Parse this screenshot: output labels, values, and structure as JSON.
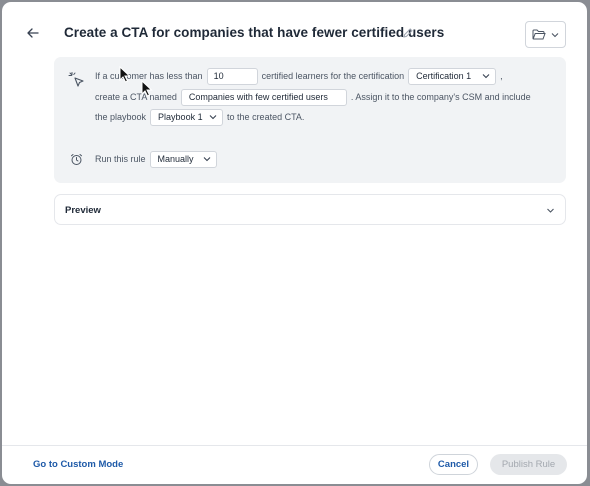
{
  "header": {
    "title": "Create a CTA for companies that have fewer certified users",
    "back_icon": "arrow-left-icon",
    "edit_icon": "pencil-icon",
    "folder_icon": "folder-icon"
  },
  "rule": {
    "icon": "pointer-click-icon",
    "text_if": "If a customer has less than",
    "learners_value": "10",
    "text_certified": "certified learners for the certification",
    "certification_selected": "Certification 1",
    "text_comma": ",",
    "text_create": "create a CTA named",
    "cta_name_value": "Companies with few certified users",
    "text_assign": ". Assign it to the company's CSM and include",
    "text_playbook": "the playbook",
    "playbook_selected": "Playbook 1",
    "text_to_created": "to the created CTA."
  },
  "schedule": {
    "icon": "alarm-clock-icon",
    "label": "Run this rule",
    "selected": "Manually"
  },
  "preview": {
    "label": "Preview"
  },
  "footer": {
    "custom_mode_link": "Go to Custom Mode",
    "cancel_label": "Cancel",
    "publish_label": "Publish Rule"
  },
  "colors": {
    "accent": "#1e5aa8",
    "panel_bg": "#f1f3f5",
    "disabled_bg": "#e5e7ea"
  }
}
